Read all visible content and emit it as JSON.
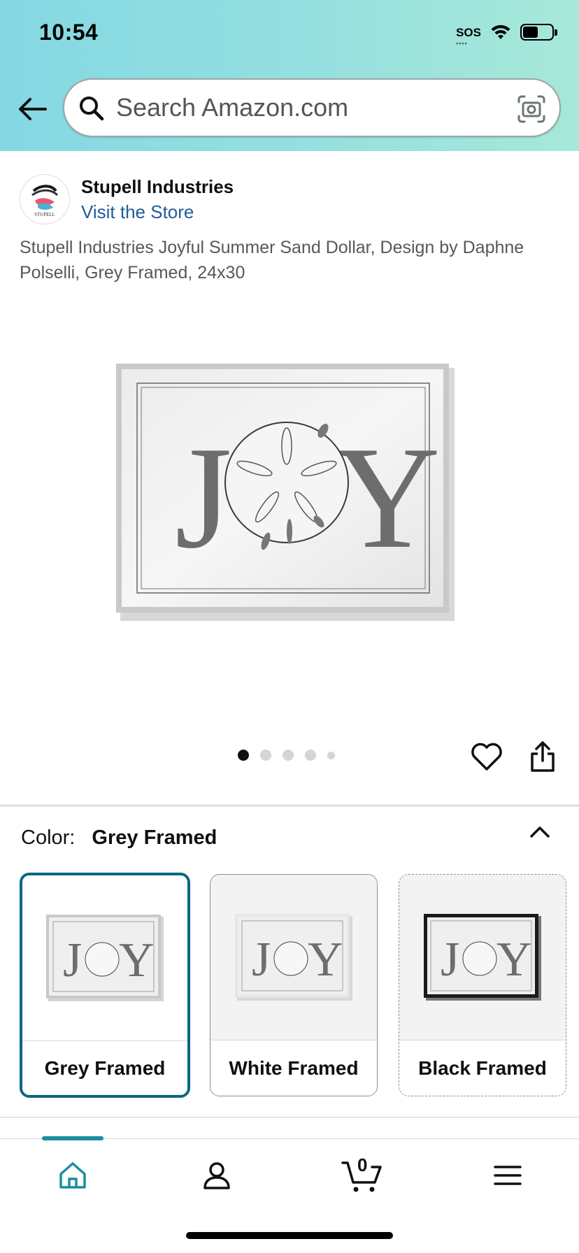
{
  "status_bar": {
    "time": "10:54",
    "sos": "SOS",
    "battery_level_percent": 55
  },
  "header": {
    "search": {
      "placeholder": "Search Amazon.com"
    },
    "colors": {
      "gradient_left": "#84d8e3",
      "gradient_right": "#a7e8d8"
    }
  },
  "brand": {
    "name": "Stupell Industries",
    "link": "Visit the Store",
    "logo_text": "STUPELL"
  },
  "product": {
    "title": "Stupell Industries Joyful Summer Sand Dollar, Design by Daphne Polselli, Grey Framed, 24x30",
    "image_text": {
      "left": "J",
      "right": "Y"
    },
    "carousel": {
      "total": 5,
      "active_index": 0
    }
  },
  "color_selector": {
    "label": "Color:",
    "selected": "Grey Framed",
    "options": [
      {
        "label": "Grey Framed",
        "frame_color": "#c9c9c9"
      },
      {
        "label": "White Framed",
        "frame_color": "#e6e6e6"
      },
      {
        "label": "Black Framed",
        "frame_color": "#1a1a1a"
      }
    ]
  },
  "bottom_nav": {
    "items": [
      "home-icon",
      "account-icon",
      "cart-icon",
      "menu-icon"
    ],
    "cart_count": "0",
    "accent_color": "#1a8fa0"
  }
}
